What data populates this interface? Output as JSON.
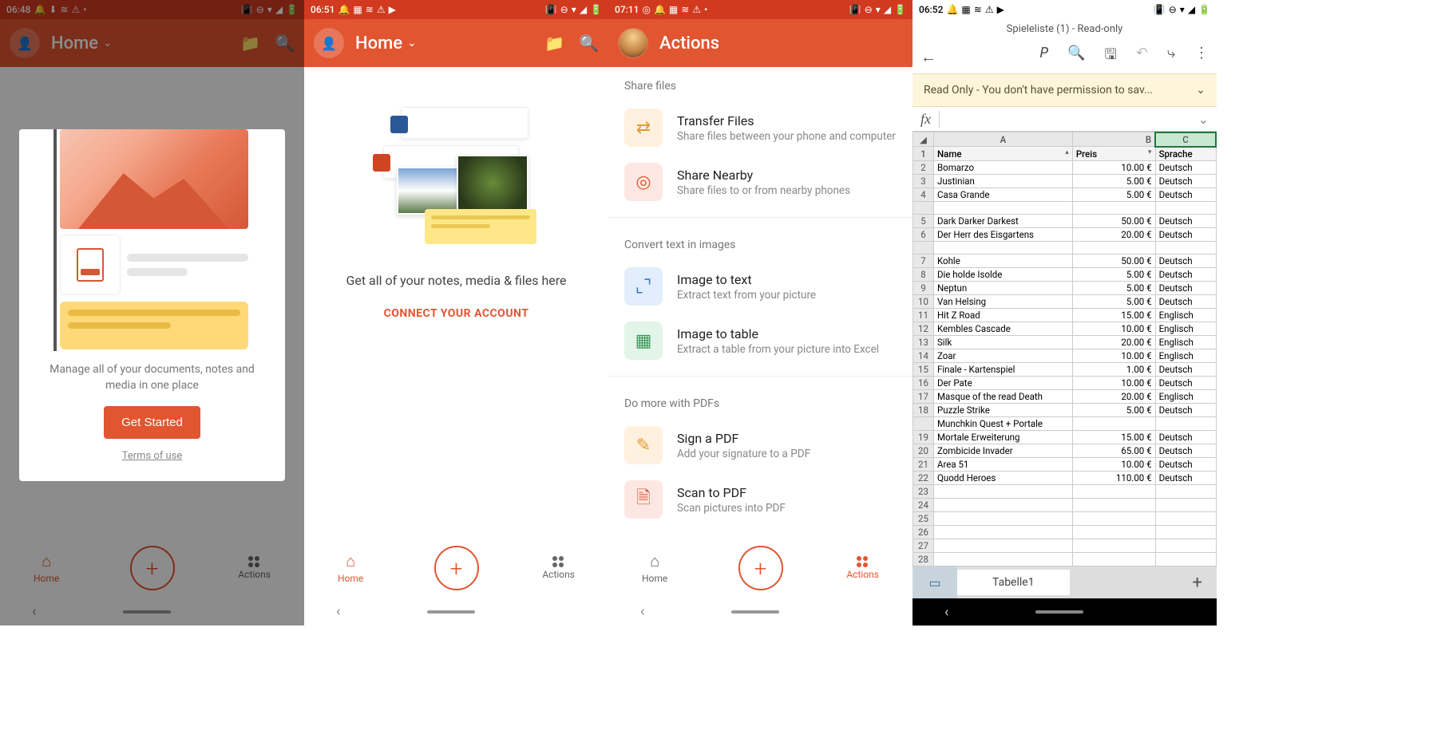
{
  "s1": {
    "time": "06:48",
    "app_title": "Home",
    "modal_text": "Manage all of your documents, notes and media in one place",
    "get_started": "Get Started",
    "terms": "Terms of use",
    "nav": {
      "home": "Home",
      "actions": "Actions"
    }
  },
  "s2": {
    "time": "06:51",
    "app_title": "Home",
    "tagline": "Get all of your notes, media & files here",
    "connect": "CONNECT YOUR ACCOUNT",
    "nav": {
      "home": "Home",
      "actions": "Actions"
    }
  },
  "s3": {
    "time": "07:11",
    "app_title": "Actions",
    "sections": {
      "share": {
        "title": "Share files",
        "transfer": {
          "t": "Transfer Files",
          "s": "Share files between your phone and computer"
        },
        "nearby": {
          "t": "Share Nearby",
          "s": "Share files to or from nearby phones"
        }
      },
      "convert": {
        "title": "Convert text in images",
        "i2t": {
          "t": "Image to text",
          "s": "Extract text from your picture"
        },
        "i2tbl": {
          "t": "Image to table",
          "s": "Extract a table from your picture into Excel"
        }
      },
      "pdf": {
        "title": "Do more with PDFs",
        "sign": {
          "t": "Sign a PDF",
          "s": "Add your signature to a PDF"
        },
        "scan": {
          "t": "Scan to PDF",
          "s": "Scan pictures into PDF"
        }
      }
    },
    "nav": {
      "home": "Home",
      "actions": "Actions"
    }
  },
  "s4": {
    "time": "06:52",
    "doc_title": "Spieleliste (1) - Read-only",
    "banner": "Read Only - You don't have permission to sav...",
    "sheet_tab": "Tabelle1",
    "headers": {
      "a": "Name",
      "b": "Preis",
      "c": "Sprache"
    },
    "rows": [
      {
        "n": "2",
        "a": "Bomarzo",
        "b": "10.00 €",
        "c": "Deutsch"
      },
      {
        "n": "3",
        "a": "Justinian",
        "b": "5.00 €",
        "c": "Deutsch"
      },
      {
        "n": "4",
        "a": "Casa Grande",
        "b": "5.00 €",
        "c": "Deutsch"
      },
      {
        "n": "",
        "a": "",
        "b": "",
        "c": ""
      },
      {
        "n": "5",
        "a": "Dark Darker Darkest",
        "b": "50.00 €",
        "c": "Deutsch"
      },
      {
        "n": "6",
        "a": "Der Herr des Eisgartens",
        "b": "20.00 €",
        "c": "Deutsch"
      },
      {
        "n": "",
        "a": "",
        "b": "",
        "c": ""
      },
      {
        "n": "7",
        "a": "Kohle",
        "b": "50.00 €",
        "c": "Deutsch"
      },
      {
        "n": "8",
        "a": "Die holde Isolde",
        "b": "5.00 €",
        "c": "Deutsch"
      },
      {
        "n": "9",
        "a": "Neptun",
        "b": "5.00 €",
        "c": "Deutsch"
      },
      {
        "n": "10",
        "a": "Van Helsing",
        "b": "5.00 €",
        "c": "Deutsch"
      },
      {
        "n": "11",
        "a": "Hit Z Road",
        "b": "15.00 €",
        "c": "Englisch"
      },
      {
        "n": "12",
        "a": "Kembles Cascade",
        "b": "10.00 €",
        "c": "Englisch"
      },
      {
        "n": "13",
        "a": "Silk",
        "b": "20.00 €",
        "c": "Englisch"
      },
      {
        "n": "14",
        "a": "Zoar",
        "b": "10.00 €",
        "c": "Englisch"
      },
      {
        "n": "15",
        "a": "Finale - Kartenspiel",
        "b": "1.00 €",
        "c": "Deutsch"
      },
      {
        "n": "16",
        "a": "Der Pate",
        "b": "10.00 €",
        "c": "Deutsch"
      },
      {
        "n": "17",
        "a": "Masque of the read Death",
        "b": "20.00 €",
        "c": "Englisch"
      },
      {
        "n": "18",
        "a": "Puzzle Strike",
        "b": "5.00 €",
        "c": "Deutsch"
      },
      {
        "n": "",
        "a": "Munchkin Quest + Portale",
        "b": "",
        "c": ""
      },
      {
        "n": "19",
        "a": "Mortale Erweiterung",
        "b": "15.00 €",
        "c": "Deutsch"
      },
      {
        "n": "20",
        "a": "Zombicide Invader",
        "b": "65.00 €",
        "c": "Deutsch"
      },
      {
        "n": "21",
        "a": "Area 51",
        "b": "10.00 €",
        "c": "Deutsch"
      },
      {
        "n": "22",
        "a": "Quodd Heroes",
        "b": "110.00 €",
        "c": "Deutsch"
      },
      {
        "n": "23",
        "a": "",
        "b": "",
        "c": ""
      },
      {
        "n": "24",
        "a": "",
        "b": "",
        "c": ""
      },
      {
        "n": "25",
        "a": "",
        "b": "",
        "c": ""
      },
      {
        "n": "26",
        "a": "",
        "b": "",
        "c": ""
      },
      {
        "n": "27",
        "a": "",
        "b": "",
        "c": ""
      },
      {
        "n": "28",
        "a": "",
        "b": "",
        "c": ""
      }
    ]
  }
}
